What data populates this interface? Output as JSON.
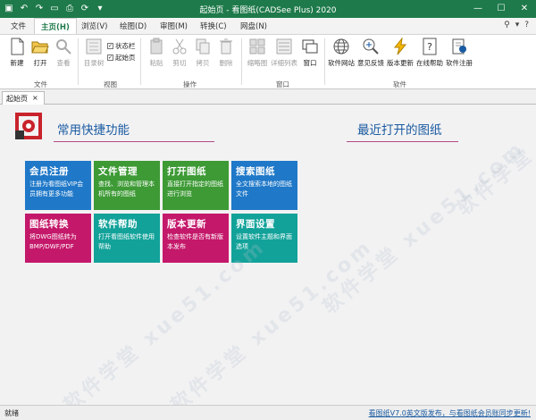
{
  "window": {
    "title": "起始页 - 看图纸(CADSee Plus) 2020",
    "quick_access": [
      "save-icon",
      "undo-icon",
      "redo-icon",
      "open-icon",
      "print-icon",
      "refresh-icon",
      "more-icon"
    ],
    "controls": [
      "—",
      "☐",
      "✕"
    ]
  },
  "menu": {
    "tabs": [
      "文件",
      "主页(H)",
      "浏览(V)",
      "绘图(D)",
      "审图(M)",
      "转换(C)",
      "网盘(N)"
    ],
    "active": "主页(H)",
    "right_icons": [
      "▾",
      "?"
    ]
  },
  "ribbon": {
    "file_group": {
      "label": "文件",
      "buttons": [
        "新建",
        "打开",
        "查看"
      ]
    },
    "view_group": {
      "label": "视图",
      "buttons": [
        "目录树"
      ],
      "checks": [
        {
          "label": "状态栏",
          "checked": true
        },
        {
          "label": "起始页",
          "checked": true
        }
      ]
    },
    "ops_group": {
      "label": "操作",
      "buttons": [
        "粘贴",
        "剪切",
        "拷贝",
        "删除"
      ]
    },
    "window_group": {
      "label": "窗口",
      "buttons": [
        "缩略图",
        "详细列表",
        "窗口"
      ]
    },
    "software_group": {
      "label": "软件",
      "buttons": [
        "软件网站",
        "意见反馈",
        "版本更新",
        "在线帮助",
        "软件注册"
      ]
    }
  },
  "doc_tab": {
    "label": "起始页",
    "close": "×"
  },
  "main": {
    "quick_title": "常用快捷功能",
    "recent_title": "最近打开的图纸",
    "tiles": [
      {
        "title": "会员注册",
        "desc": "注册为看图纸VIP会员拥有更多功能",
        "color": "#1f78c8"
      },
      {
        "title": "文件管理",
        "desc": "查找、浏览和管理本机所有的图纸",
        "color": "#3d9a35"
      },
      {
        "title": "打开图纸",
        "desc": "直接打开指定的图纸进行浏览",
        "color": "#3d9a35"
      },
      {
        "title": "搜索图纸",
        "desc": "全文搜索本地的图纸文件",
        "color": "#1f78c8"
      },
      {
        "title": "图纸转换",
        "desc": "将DWG图纸转为BMP/DWF/PDF",
        "color": "#c4186a"
      },
      {
        "title": "软件帮助",
        "desc": "打开看图纸软件使用帮助",
        "color": "#12a29a"
      },
      {
        "title": "版本更新",
        "desc": "检查软件是否有新版本发布",
        "color": "#c4186a"
      },
      {
        "title": "界面设置",
        "desc": "设置软件主题和界面选项",
        "color": "#12a29a"
      }
    ]
  },
  "watermark": "软件学堂 xue51.com",
  "status": {
    "left": "就绪",
    "right": "看图纸V7.0英文版发布，与看图纸会员账同步更新!"
  }
}
